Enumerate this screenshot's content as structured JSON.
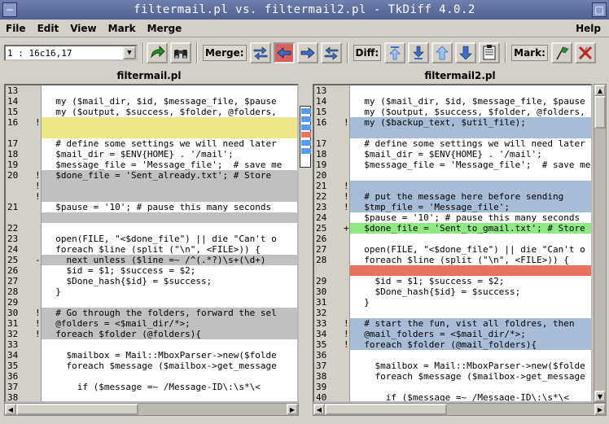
{
  "window": {
    "title": "filtermail.pl vs. filtermail2.pl - TkDiff 4.0.2"
  },
  "menubar": {
    "items": [
      "File",
      "Edit",
      "View",
      "Mark",
      "Merge"
    ],
    "help": "Help"
  },
  "toolbar": {
    "diff_selector_value": "1     : 16c16,17",
    "merge_label": "Merge:",
    "diff_label": "Diff:",
    "mark_label": "Mark:"
  },
  "left_pane": {
    "filename": "filtermail.pl",
    "lines": [
      {
        "num": "13",
        "mark": "",
        "text": "",
        "bg": ""
      },
      {
        "num": "14",
        "mark": "",
        "text": "  my ($mail_dir, $id, $message_file, $pause",
        "bg": ""
      },
      {
        "num": "15",
        "mark": "",
        "text": "  my ($output, $success, $folder, @folders,",
        "bg": ""
      },
      {
        "num": "16",
        "mark": "!",
        "text": "",
        "bg": "yellow"
      },
      {
        "num": "",
        "mark": "",
        "text": "",
        "bg": "yellow"
      },
      {
        "num": "17",
        "mark": "",
        "text": "  # define some settings we will need later",
        "bg": ""
      },
      {
        "num": "18",
        "mark": "",
        "text": "  $mail_dir = $ENV{HOME} . '/mail';",
        "bg": ""
      },
      {
        "num": "19",
        "mark": "",
        "text": "  $message_file = 'Message_file';  # save me",
        "bg": ""
      },
      {
        "num": "20",
        "mark": "!",
        "text": "  $done_file = 'Sent_already.txt'; # Store",
        "bg": "grey"
      },
      {
        "num": "",
        "mark": "!",
        "text": "",
        "bg": "grey"
      },
      {
        "num": "",
        "mark": "!",
        "text": "",
        "bg": "grey"
      },
      {
        "num": "21",
        "mark": "",
        "text": "  $pause = '10'; # pause this many seconds",
        "bg": ""
      },
      {
        "num": "",
        "mark": "",
        "text": "",
        "bg": "grey"
      },
      {
        "num": "22",
        "mark": "",
        "text": "",
        "bg": ""
      },
      {
        "num": "23",
        "mark": "",
        "text": "  open(FILE, \"<$done_file\") || die \"Can't o",
        "bg": ""
      },
      {
        "num": "24",
        "mark": "",
        "text": "  foreach $line (split (\"\\n\", <FILE>)) {",
        "bg": ""
      },
      {
        "num": "25",
        "mark": "-",
        "text": "    next unless ($line =~ /^(.*?)\\s+(\\d+)",
        "bg": "grey"
      },
      {
        "num": "26",
        "mark": "",
        "text": "    $id = $1; $success = $2;",
        "bg": ""
      },
      {
        "num": "27",
        "mark": "",
        "text": "    $Done_hash{$id} = $success;",
        "bg": ""
      },
      {
        "num": "28",
        "mark": "",
        "text": "  }",
        "bg": ""
      },
      {
        "num": "29",
        "mark": "",
        "text": "",
        "bg": ""
      },
      {
        "num": "30",
        "mark": "!",
        "text": "  # Go through the folders, forward the sel",
        "bg": "grey"
      },
      {
        "num": "31",
        "mark": "!",
        "text": "  @folders = <$mail_dir/*>;",
        "bg": "grey"
      },
      {
        "num": "32",
        "mark": "!",
        "text": "  foreach $folder (@folders){",
        "bg": "grey"
      },
      {
        "num": "33",
        "mark": "",
        "text": "",
        "bg": ""
      },
      {
        "num": "34",
        "mark": "",
        "text": "    $mailbox = Mail::MboxParser->new($folde",
        "bg": ""
      },
      {
        "num": "35",
        "mark": "",
        "text": "    foreach $message ($mailbox->get_message",
        "bg": ""
      },
      {
        "num": "36",
        "mark": "",
        "text": "",
        "bg": ""
      },
      {
        "num": "37",
        "mark": "",
        "text": "      if ($message =~ /Message-ID\\:\\s*\\<",
        "bg": ""
      },
      {
        "num": "38",
        "mark": "",
        "text": "",
        "bg": ""
      }
    ]
  },
  "right_pane": {
    "filename": "filtermail2.pl",
    "lines": [
      {
        "num": "13",
        "mark": "",
        "text": "",
        "bg": ""
      },
      {
        "num": "14",
        "mark": "",
        "text": "  my ($mail_dir, $id, $message_file, $pause",
        "bg": ""
      },
      {
        "num": "15",
        "mark": "",
        "text": "  my ($output, $success, $folder, @folders,",
        "bg": ""
      },
      {
        "num": "16",
        "mark": "!",
        "text": "  my ($backup_text, $util_file);",
        "bg": "blue"
      },
      {
        "num": "",
        "mark": "",
        "text": "",
        "bg": "blue"
      },
      {
        "num": "17",
        "mark": "",
        "text": "  # define some settings we will need later",
        "bg": ""
      },
      {
        "num": "18",
        "mark": "",
        "text": "  $mail_dir = $ENV{HOME} . '/mail';",
        "bg": ""
      },
      {
        "num": "19",
        "mark": "",
        "text": "  $message_file = 'Message_file';  # save me",
        "bg": ""
      },
      {
        "num": "20",
        "mark": "",
        "text": "",
        "bg": ""
      },
      {
        "num": "21",
        "mark": "!",
        "text": "",
        "bg": "blue"
      },
      {
        "num": "22",
        "mark": "!",
        "text": "  # put the message here before sending",
        "bg": "blue"
      },
      {
        "num": "23",
        "mark": "!",
        "text": "  $tmp_file = 'Message_file';",
        "bg": "blue"
      },
      {
        "num": "24",
        "mark": "",
        "text": "  $pause = '10'; # pause this many seconds",
        "bg": ""
      },
      {
        "num": "25",
        "mark": "+",
        "text": "  $done_file = 'Sent_to_gmail.txt'; # Store",
        "bg": "green"
      },
      {
        "num": "26",
        "mark": "",
        "text": "",
        "bg": ""
      },
      {
        "num": "27",
        "mark": "",
        "text": "  open(FILE, \"<$done_file\") || die \"Can't o",
        "bg": ""
      },
      {
        "num": "28",
        "mark": "",
        "text": "  foreach $line (split (\"\\n\", <FILE>)) {",
        "bg": ""
      },
      {
        "num": "",
        "mark": "",
        "text": "",
        "bg": "red"
      },
      {
        "num": "29",
        "mark": "",
        "text": "    $id = $1; $success = $2;",
        "bg": ""
      },
      {
        "num": "30",
        "mark": "",
        "text": "    $Done_hash{$id} = $success;",
        "bg": ""
      },
      {
        "num": "31",
        "mark": "",
        "text": "  }",
        "bg": ""
      },
      {
        "num": "32",
        "mark": "",
        "text": "",
        "bg": ""
      },
      {
        "num": "33",
        "mark": "!",
        "text": "  # start the fun, vist all foldres, then",
        "bg": "blue"
      },
      {
        "num": "34",
        "mark": "!",
        "text": "  @mail_folders = <$mail_dir/*>;",
        "bg": "blue"
      },
      {
        "num": "35",
        "mark": "!",
        "text": "  foreach $folder (@mail_folders){",
        "bg": "blue"
      },
      {
        "num": "36",
        "mark": "",
        "text": "",
        "bg": ""
      },
      {
        "num": "37",
        "mark": "",
        "text": "    $mailbox = Mail::MboxParser->new($folde",
        "bg": ""
      },
      {
        "num": "38",
        "mark": "",
        "text": "    foreach $message ($mailbox->get_message",
        "bg": ""
      },
      {
        "num": "39",
        "mark": "",
        "text": "",
        "bg": ""
      },
      {
        "num": "40",
        "mark": "",
        "text": "      if ($message =~ /Message-ID\\:\\s*\\<",
        "bg": ""
      },
      {
        "num": "41",
        "mark": "",
        "text": "",
        "bg": ""
      }
    ]
  },
  "diff_map": {
    "segments": [
      {
        "pos": 0.0,
        "color": "#5a9be8"
      },
      {
        "pos": 0.14,
        "color": "#5a9be8"
      },
      {
        "pos": 0.28,
        "color": "#5a9be8"
      },
      {
        "pos": 0.42,
        "color": "#e8735f"
      },
      {
        "pos": 0.56,
        "color": "#5a9be8"
      },
      {
        "pos": 0.7,
        "color": "#5a9be8"
      }
    ]
  },
  "colors": {
    "changed_left": "#ece88a",
    "changed": "#a9bcd5",
    "deleted": "#c0c0c0",
    "added": "#8fea84",
    "removed": "#e8735f"
  }
}
